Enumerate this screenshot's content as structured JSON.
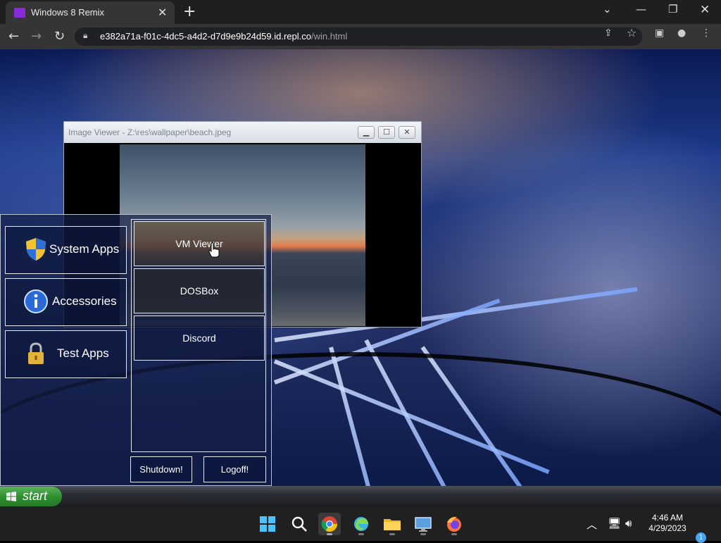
{
  "browser": {
    "tab_title": "Windows 8 Remix",
    "url_host": "e382a71a-f01c-4dc5-a4d2-d7d9e9b24d59.id.repl.co",
    "url_path": "/win.html"
  },
  "image_viewer": {
    "title": "Image Viewer - Z:\\res\\wallpaper\\beach.jpeg"
  },
  "start_menu": {
    "categories": [
      {
        "label": "System Apps",
        "icon": "shield-icon"
      },
      {
        "label": "Accessories",
        "icon": "info-icon"
      },
      {
        "label": "Test Apps",
        "icon": "lock-icon"
      }
    ],
    "apps": [
      {
        "label": "VM Viewer"
      },
      {
        "label": "DOSBox"
      },
      {
        "label": "Discord"
      }
    ],
    "shutdown_label": "Shutdown!",
    "logoff_label": "Logoff!"
  },
  "xp_taskbar": {
    "start_label": "start"
  },
  "system_taskbar": {
    "time": "4:46 AM",
    "date": "4/29/2023",
    "notification_count": "1"
  },
  "colors": {
    "start_green": "#2f8f2f",
    "tab_accent": "#8a2bd9",
    "notification_blue": "#4aa3f0"
  }
}
